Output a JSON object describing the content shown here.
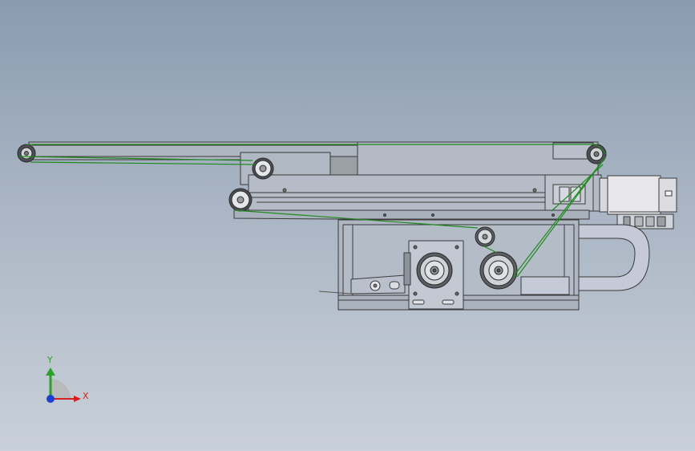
{
  "window": {
    "kind": "CAD graphics viewport",
    "background": "#a3afbf"
  },
  "triad": {
    "y_label": "Y",
    "x_label": "X",
    "colors": {
      "x": "#d42020",
      "y": "#2aa22a",
      "z": "#1f3fd0",
      "plane": "#b8b8b8"
    }
  },
  "model": {
    "line_color": "#3a3a3a",
    "belt_color": "#1f8a1f",
    "motor_color": "#e8e8ec"
  }
}
